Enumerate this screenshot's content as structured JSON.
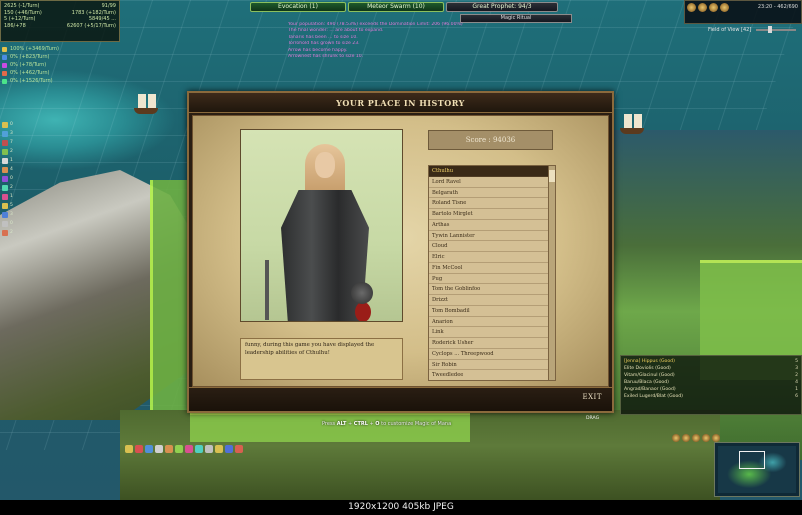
{
  "hud": {
    "stats": [
      [
        "2625 (-1/Turn)",
        "91/99"
      ],
      [
        "150 (+46/Turn)",
        "1783 (+182/Turn)"
      ],
      [
        "5 (+12/Turn)",
        "5849/45 ..."
      ],
      [
        "186/+78",
        "62607 (+5/17/Turn)"
      ]
    ],
    "resources": [
      {
        "label": "100% (+3469/Turn)",
        "color": "#e3c24b"
      },
      {
        "label": "0% (+823/Turn)",
        "color": "#4b8de3"
      },
      {
        "label": "0% (+78/Turn)",
        "color": "#c94be3"
      },
      {
        "label": "0% (+462/Turn)",
        "color": "#e36a4b"
      },
      {
        "label": "0% (+1526/Turn)",
        "color": "#4be38a"
      }
    ],
    "top_buttons": [
      "Evocation (1)",
      "Meteor Swarm (10)",
      "Great Prophet: 94/3"
    ],
    "magic_ritual": "Magic Ritual",
    "messages": [
      "Your population: 490 (78.53%) exceeds the Domination Limit: 206 (96.00%)",
      "The final wonder: ... are about to expand.",
      "Tanaris has been ... to size 10.",
      "Torrohold has grown to size 23.",
      "Arrow has become happy.",
      "Arrownest has shrunk to size 10."
    ],
    "clock": "23:20 - 462/690",
    "field_of_view": "Field of View [42]"
  },
  "left_column": [
    "0",
    "3",
    "7",
    "2",
    "1",
    "4",
    "0",
    "2",
    "1",
    "5",
    "3",
    "0",
    "2"
  ],
  "dialog": {
    "title": "YOUR PLACE IN HISTORY",
    "score": "Score : 94036",
    "message": "funny, during this game you have displayed the leadership abilities of Cthulhu!",
    "leaders": [
      "Cthulhu",
      "Lord Ravel",
      "Belgarath",
      "Roland Tisne",
      "Bartolo Mirglet",
      "Arthas",
      "Tywin Lannister",
      "Cloud",
      "Elric",
      "Fin McCool",
      "Pug",
      "Tom the Goblinfoo",
      "Drizzt",
      "Tom Bombadil",
      "Anarion",
      "Link",
      "Roderick Usher",
      "Cyclops ... Threepwood",
      "Sir Robin",
      "Tweedledee"
    ],
    "selected_index": 0,
    "exit_label": "EXIT"
  },
  "bottom": {
    "hint_prefix": "Press",
    "hint_keys": [
      "ALT",
      "CTRL",
      "O"
    ],
    "hint_suffix": "to customize Magic of Mana",
    "drag_label": "DRAG",
    "units": [
      {
        "name": "[Jenna] Hippus (Good)",
        "count": "5"
      },
      {
        "name": "Elite Doviolis (Good)",
        "count": "3"
      },
      {
        "name": "Vitam/Glacinul (Good)",
        "count": "2"
      },
      {
        "name": "Baruu/Blaca (Good)",
        "count": "4"
      },
      {
        "name": "Angrad/Banaor (Good)",
        "count": "1"
      },
      {
        "name": "Exiled Lugerd/Blat (Good)",
        "count": "6"
      }
    ]
  },
  "caption": "1920x1200  405kb  JPEG",
  "colors": {
    "accent_green": "#8bbf5e",
    "gold": "#f3d36b",
    "parchment": "#d4c095"
  }
}
